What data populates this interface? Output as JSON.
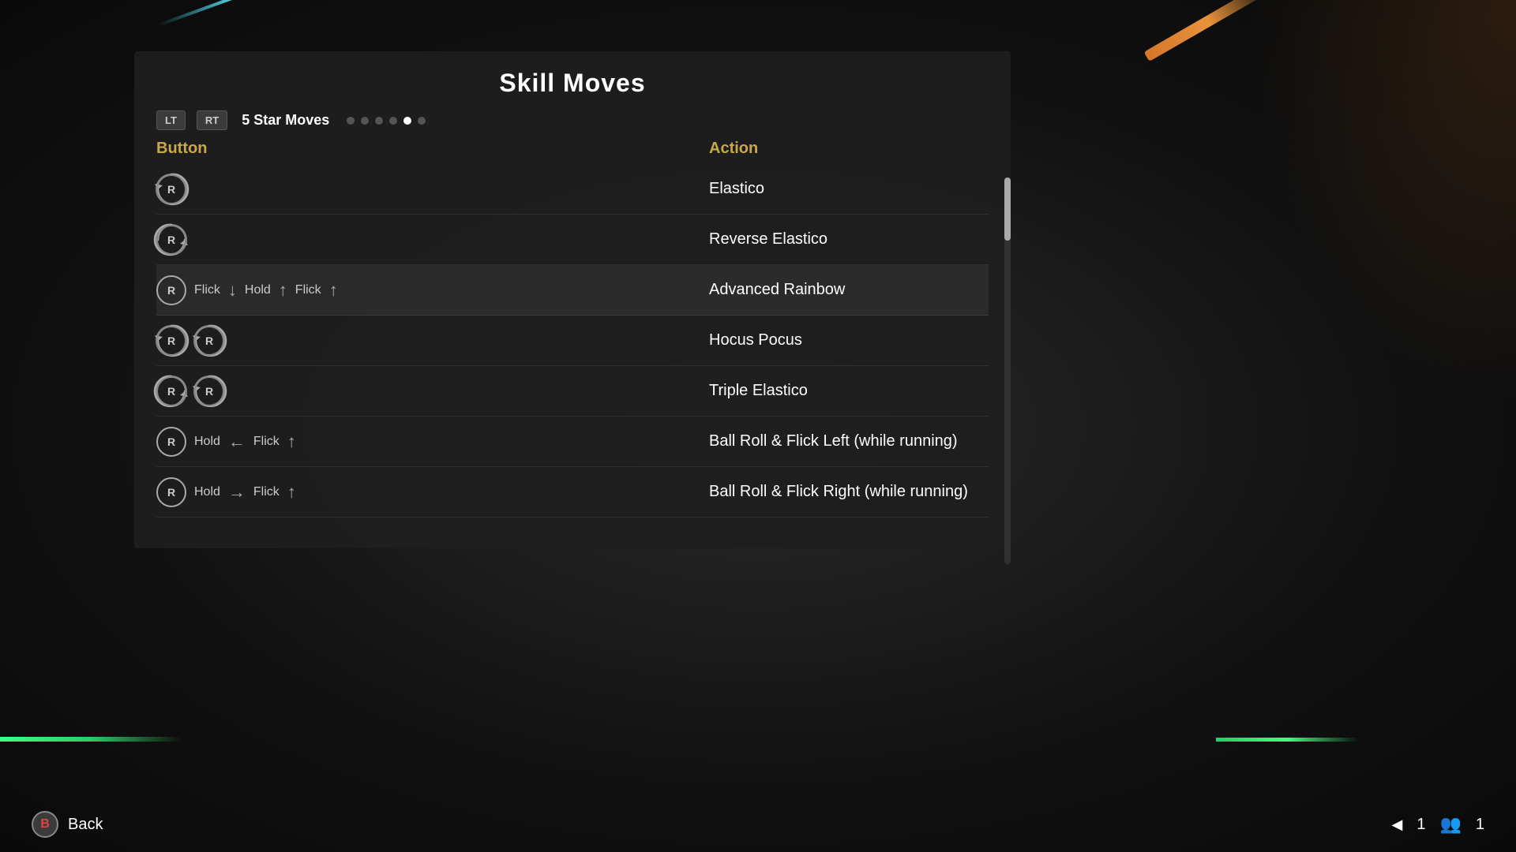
{
  "title": "Skill Moves",
  "tabs": {
    "lt_label": "LT",
    "rt_label": "RT",
    "current_tab": "5 Star Moves",
    "dots": [
      false,
      false,
      false,
      false,
      true,
      false
    ]
  },
  "columns": {
    "button_label": "Button",
    "action_label": "Action"
  },
  "moves": [
    {
      "id": 0,
      "button_type": "rotate_cw",
      "button_desc": "",
      "action": "Elastico",
      "selected": false
    },
    {
      "id": 1,
      "button_type": "rotate_ccw",
      "button_desc": "",
      "action": "Reverse Elastico",
      "selected": false
    },
    {
      "id": 2,
      "button_type": "flick_combo",
      "button_desc": "Flick ↓ Hold ↑ Flick ↑",
      "action": "Advanced Rainbow",
      "selected": true
    },
    {
      "id": 3,
      "button_type": "double_rotate",
      "button_desc": "",
      "action": "Hocus Pocus",
      "selected": false
    },
    {
      "id": 4,
      "button_type": "double_rotate_mixed",
      "button_desc": "",
      "action": "Triple Elastico",
      "selected": false
    },
    {
      "id": 5,
      "button_type": "hold_flick_left",
      "button_desc": "Hold ← Flick ↑",
      "action": "Ball Roll & Flick Left (while running)",
      "selected": false
    },
    {
      "id": 6,
      "button_type": "hold_flick_right",
      "button_desc": "Hold → Flick ↑",
      "action": "Ball Roll & Flick Right (while running)",
      "selected": false
    }
  ],
  "footer": {
    "back_label": "Back",
    "b_button": "B",
    "page_current": "1",
    "page_total": "1"
  },
  "colors": {
    "accent_gold": "#c8a84b",
    "text_white": "#ffffff",
    "text_gray": "#cccccc",
    "selected_bg": "rgba(255,255,255,0.07)",
    "bg_panel": "rgba(30,30,30,0.92)"
  }
}
